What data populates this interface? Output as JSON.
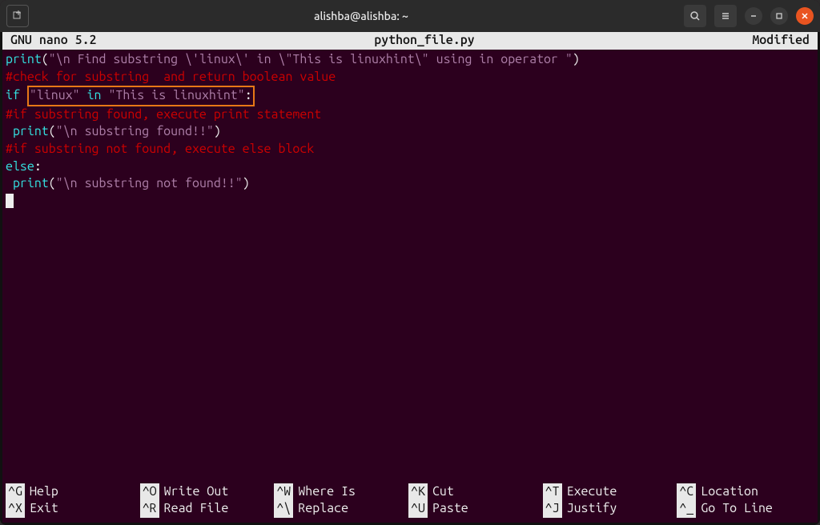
{
  "titlebar": {
    "title": "alishba@alishba: ~"
  },
  "nano": {
    "version": "GNU nano 5.2",
    "filename": "python_file.py",
    "status": "Modified"
  },
  "code": {
    "l1_fn": "print",
    "l1_open": "(",
    "l1_str": "\"\\n Find substring \\'linux\\' in \\\"This is linuxhint\\\" using in operator \"",
    "l1_close": ")",
    "l2": "#check for substring  and return boolean value",
    "l3_if": "if",
    "l3_space": " ",
    "l3_box_a": "\"linux\"",
    "l3_box_in": " in ",
    "l3_box_b": "\"This is linuxhint\"",
    "l3_colon": ":",
    "l4": "#if substring found, execute print statement",
    "l5_indent": " ",
    "l5_fn": "print",
    "l5_open": "(",
    "l5_str": "\"\\n substring found!!\"",
    "l5_close": ")",
    "l6": "#if substring not found, execute else block",
    "l7_else": "else",
    "l7_colon": ":",
    "l8_indent": " ",
    "l8_fn": "print",
    "l8_open": "(",
    "l8_str": "\"\\n substring not found!!\"",
    "l8_close": ")"
  },
  "shortcuts": {
    "row1": [
      {
        "key": "^G",
        "label": "Help"
      },
      {
        "key": "^O",
        "label": "Write Out"
      },
      {
        "key": "^W",
        "label": "Where Is"
      },
      {
        "key": "^K",
        "label": "Cut"
      },
      {
        "key": "^T",
        "label": "Execute"
      },
      {
        "key": "^C",
        "label": "Location"
      }
    ],
    "row2": [
      {
        "key": "^X",
        "label": "Exit"
      },
      {
        "key": "^R",
        "label": "Read File"
      },
      {
        "key": "^\\",
        "label": "Replace"
      },
      {
        "key": "^U",
        "label": "Paste"
      },
      {
        "key": "^J",
        "label": "Justify"
      },
      {
        "key": "^_",
        "label": "Go To Line"
      }
    ]
  }
}
